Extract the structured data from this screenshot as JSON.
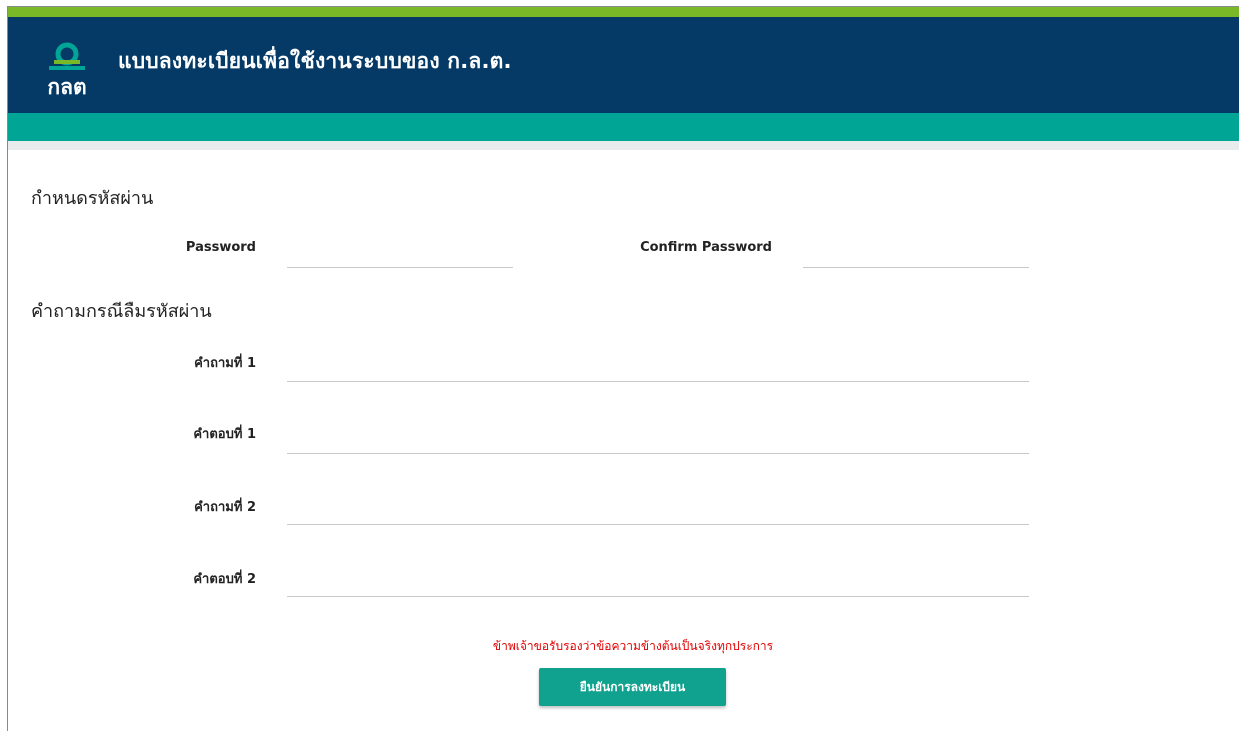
{
  "header": {
    "logo_text": "กลต",
    "title": "แบบลงทะเบียนเพื่อใช้งานระบบของ ก.ล.ต."
  },
  "password_section": {
    "title": "กำหนดรหัสผ่าน",
    "password_label": "Password",
    "confirm_label": "Confirm Password"
  },
  "security_section": {
    "title": "คำถามกรณีลืมรหัสผ่าน",
    "question1_label": "คำถามที่ 1",
    "answer1_label": "คำตอบที่ 1",
    "question2_label": "คำถามที่ 2",
    "answer2_label": "คำตอบที่ 2"
  },
  "notice": "ข้าพเจ้าขอรับรองว่าข้อความข้างต้นเป็นจริงทุกประการ",
  "submit_label": "ยืนยันการลงทะเบียน",
  "colors": {
    "header_bg": "#053a66",
    "accent_green": "#79b928",
    "teal": "#00a596",
    "button": "#10a28f",
    "notice_red": "#e30000"
  },
  "icons": {
    "logo": "sec-logo-icon"
  }
}
